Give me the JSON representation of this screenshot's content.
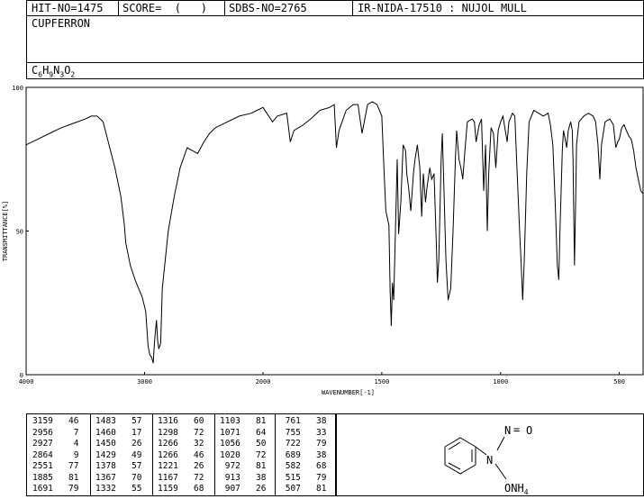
{
  "header": {
    "hit_no": "HIT-NO=1475",
    "score": "SCORE=  (   )",
    "sdbs_no": "SDBS-NO=2765",
    "ir_info": "IR-NIDA-17510 : NUJOL MULL",
    "compound": "CUPFERRON",
    "formula": {
      "c": "C",
      "c_n": "6",
      "h": "H",
      "h_n": "9",
      "n": "N",
      "n_n": "3",
      "o": "O",
      "o_n": "2"
    }
  },
  "chart_data": {
    "type": "line",
    "title": "",
    "xlabel": "WAVENUMBER[-1]",
    "ylabel": "TRANSMITTANCE[%]",
    "xlim": [
      4000,
      400
    ],
    "ylim": [
      0,
      100
    ],
    "x_ticks": [
      4000,
      3000,
      2000,
      1500,
      1000,
      500
    ],
    "y_ticks": [
      0,
      50,
      100
    ],
    "grid": false,
    "series": [
      {
        "points": [
          [
            4000,
            80
          ],
          [
            3900,
            82
          ],
          [
            3800,
            84
          ],
          [
            3700,
            86
          ],
          [
            3600,
            87.5
          ],
          [
            3500,
            89
          ],
          [
            3450,
            90
          ],
          [
            3400,
            90
          ],
          [
            3350,
            88
          ],
          [
            3300,
            80
          ],
          [
            3250,
            72
          ],
          [
            3200,
            62
          ],
          [
            3170,
            52
          ],
          [
            3159,
            46
          ],
          [
            3120,
            38
          ],
          [
            3080,
            33
          ],
          [
            3050,
            30
          ],
          [
            3020,
            27
          ],
          [
            2990,
            22
          ],
          [
            2970,
            10
          ],
          [
            2956,
            7
          ],
          [
            2940,
            6
          ],
          [
            2927,
            4
          ],
          [
            2915,
            12
          ],
          [
            2900,
            19
          ],
          [
            2890,
            12
          ],
          [
            2880,
            9
          ],
          [
            2864,
            11
          ],
          [
            2850,
            30
          ],
          [
            2800,
            50
          ],
          [
            2750,
            62
          ],
          [
            2700,
            72
          ],
          [
            2640,
            79
          ],
          [
            2551,
            77
          ],
          [
            2500,
            81
          ],
          [
            2450,
            84
          ],
          [
            2400,
            86
          ],
          [
            2300,
            88
          ],
          [
            2200,
            90
          ],
          [
            2100,
            91
          ],
          [
            2050,
            92
          ],
          [
            2000,
            93
          ],
          [
            1960,
            88
          ],
          [
            1940,
            90
          ],
          [
            1900,
            91
          ],
          [
            1885,
            81
          ],
          [
            1870,
            85
          ],
          [
            1830,
            87
          ],
          [
            1800,
            89
          ],
          [
            1760,
            92
          ],
          [
            1720,
            93
          ],
          [
            1700,
            94
          ],
          [
            1691,
            79
          ],
          [
            1680,
            85
          ],
          [
            1650,
            92
          ],
          [
            1620,
            94
          ],
          [
            1600,
            94
          ],
          [
            1583,
            84
          ],
          [
            1560,
            94
          ],
          [
            1540,
            95
          ],
          [
            1520,
            94
          ],
          [
            1500,
            90
          ],
          [
            1490,
            70
          ],
          [
            1483,
            57
          ],
          [
            1470,
            52
          ],
          [
            1465,
            30
          ],
          [
            1460,
            17
          ],
          [
            1455,
            32
          ],
          [
            1450,
            26
          ],
          [
            1445,
            42
          ],
          [
            1435,
            75
          ],
          [
            1429,
            49
          ],
          [
            1420,
            60
          ],
          [
            1410,
            80
          ],
          [
            1400,
            78
          ],
          [
            1395,
            70
          ],
          [
            1387,
            65
          ],
          [
            1378,
            57
          ],
          [
            1367,
            70
          ],
          [
            1360,
            75
          ],
          [
            1350,
            80
          ],
          [
            1340,
            72
          ],
          [
            1332,
            55
          ],
          [
            1325,
            70
          ],
          [
            1316,
            60
          ],
          [
            1310,
            65
          ],
          [
            1298,
            72
          ],
          [
            1290,
            68
          ],
          [
            1280,
            70
          ],
          [
            1270,
            45
          ],
          [
            1266,
            32
          ],
          [
            1260,
            40
          ],
          [
            1250,
            75
          ],
          [
            1245,
            84
          ],
          [
            1240,
            70
          ],
          [
            1230,
            40
          ],
          [
            1221,
            26
          ],
          [
            1210,
            30
          ],
          [
            1200,
            50
          ],
          [
            1190,
            75
          ],
          [
            1185,
            85
          ],
          [
            1175,
            75
          ],
          [
            1167,
            72
          ],
          [
            1163,
            70
          ],
          [
            1159,
            68
          ],
          [
            1150,
            78
          ],
          [
            1140,
            88
          ],
          [
            1120,
            89
          ],
          [
            1110,
            88
          ],
          [
            1103,
            81
          ],
          [
            1090,
            87
          ],
          [
            1080,
            89
          ],
          [
            1071,
            64
          ],
          [
            1063,
            80
          ],
          [
            1056,
            50
          ],
          [
            1050,
            70
          ],
          [
            1040,
            86
          ],
          [
            1030,
            84
          ],
          [
            1020,
            72
          ],
          [
            1010,
            85
          ],
          [
            1000,
            88
          ],
          [
            990,
            90
          ],
          [
            980,
            85
          ],
          [
            972,
            81
          ],
          [
            965,
            88
          ],
          [
            950,
            91
          ],
          [
            940,
            90
          ],
          [
            930,
            70
          ],
          [
            920,
            50
          ],
          [
            913,
            38
          ],
          [
            907,
            26
          ],
          [
            900,
            40
          ],
          [
            890,
            70
          ],
          [
            880,
            88
          ],
          [
            860,
            92
          ],
          [
            840,
            91
          ],
          [
            820,
            90
          ],
          [
            800,
            91
          ],
          [
            790,
            87
          ],
          [
            780,
            80
          ],
          [
            770,
            60
          ],
          [
            761,
            38
          ],
          [
            755,
            33
          ],
          [
            750,
            50
          ],
          [
            740,
            78
          ],
          [
            735,
            85
          ],
          [
            728,
            82
          ],
          [
            722,
            79
          ],
          [
            715,
            85
          ],
          [
            705,
            88
          ],
          [
            698,
            85
          ],
          [
            695,
            75
          ],
          [
            689,
            38
          ],
          [
            684,
            60
          ],
          [
            680,
            80
          ],
          [
            670,
            88
          ],
          [
            650,
            90
          ],
          [
            630,
            91
          ],
          [
            610,
            90
          ],
          [
            600,
            88
          ],
          [
            590,
            80
          ],
          [
            582,
            68
          ],
          [
            575,
            80
          ],
          [
            560,
            88
          ],
          [
            540,
            89
          ],
          [
            525,
            87
          ],
          [
            515,
            79
          ],
          [
            507,
            81
          ],
          [
            500,
            82
          ],
          [
            490,
            86
          ],
          [
            480,
            87
          ],
          [
            470,
            85
          ],
          [
            460,
            83
          ],
          [
            450,
            82
          ],
          [
            440,
            78
          ],
          [
            430,
            72
          ],
          [
            420,
            68
          ],
          [
            410,
            64
          ],
          [
            400,
            63
          ]
        ]
      }
    ]
  },
  "peak_table": {
    "columns": [
      [
        [
          "3159",
          "46"
        ],
        [
          "2956",
          "7"
        ],
        [
          "2927",
          "4"
        ],
        [
          "2864",
          "9"
        ],
        [
          "2551",
          "77"
        ],
        [
          "1885",
          "81"
        ],
        [
          "1691",
          "79"
        ]
      ],
      [
        [
          "1483",
          "57"
        ],
        [
          "1460",
          "17"
        ],
        [
          "1450",
          "26"
        ],
        [
          "1429",
          "49"
        ],
        [
          "1378",
          "57"
        ],
        [
          "1367",
          "70"
        ],
        [
          "1332",
          "55"
        ]
      ],
      [
        [
          "1316",
          "60"
        ],
        [
          "1298",
          "72"
        ],
        [
          "1266",
          "32"
        ],
        [
          "1266",
          "46"
        ],
        [
          "1221",
          "26"
        ],
        [
          "1167",
          "72"
        ],
        [
          "1159",
          "68"
        ]
      ],
      [
        [
          "1103",
          "81"
        ],
        [
          "1071",
          "64"
        ],
        [
          "1056",
          "50"
        ],
        [
          "1020",
          "72"
        ],
        [
          "972",
          "81"
        ],
        [
          "913",
          "38"
        ],
        [
          "907",
          "26"
        ]
      ],
      [
        [
          "761",
          "38"
        ],
        [
          "755",
          "33"
        ],
        [
          "722",
          "79"
        ],
        [
          "689",
          "38"
        ],
        [
          "582",
          "68"
        ],
        [
          "515",
          "79"
        ],
        [
          "507",
          "81"
        ]
      ]
    ]
  },
  "structure": {
    "label_nitroso_n": "N",
    "label_nitroso_eq": "=",
    "label_nitroso_o": "O",
    "label_amine_n": "N",
    "label_onh4": "ONH",
    "label_onh4_sub": "4"
  }
}
